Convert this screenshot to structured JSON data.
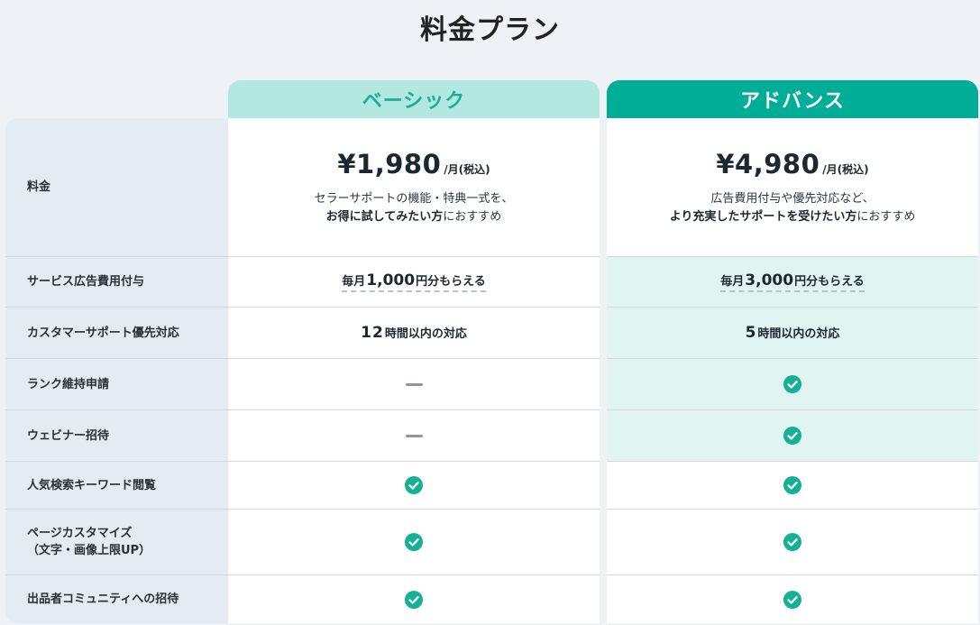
{
  "title": "料金プラン",
  "plans": {
    "basic": {
      "name": "ベーシック",
      "price": "¥1,980",
      "price_unit": "/月(税込)",
      "desc_line1": "セラーサポートの機能・特典一式を、",
      "desc_line2_bold": "お得に試してみたい方",
      "desc_line2_rest": "におすすめ",
      "ad_prefix": "毎月",
      "ad_amount": "1,000",
      "ad_suffix": "円分もらえる",
      "support_hours": "12",
      "support_suffix": "時間以内の対応"
    },
    "advance": {
      "name": "アドバンス",
      "price": "¥4,980",
      "price_unit": "/月(税込)",
      "desc_line1": "広告費用付与や優先対応など、",
      "desc_line2_bold": "より充実したサポートを受けたい方",
      "desc_line2_rest": "におすすめ",
      "ad_prefix": "毎月",
      "ad_amount": "3,000",
      "ad_suffix": "円分もらえる",
      "support_hours": "5",
      "support_suffix": "時間以内の対応"
    }
  },
  "rows": {
    "price": "料金",
    "ad": "サービス広告費用付与",
    "support": "カスタマーサポート優先対応",
    "rank": "ランク維持申請",
    "webinar": "ウェビナー招待",
    "keyword": "人気検索キーワード閲覧",
    "page_custom_line1": "ページカスタマイズ",
    "page_custom_line2": "（文字・画像上限UP）",
    "community": "出品者コミュニティへの招待"
  },
  "features": {
    "rank": {
      "basic": "none",
      "advance": "check"
    },
    "webinar": {
      "basic": "none",
      "advance": "check"
    },
    "keyword": {
      "basic": "check",
      "advance": "check"
    },
    "page_custom": {
      "basic": "check",
      "advance": "check"
    },
    "community": {
      "basic": "check",
      "advance": "check"
    }
  },
  "colors": {
    "accent": "#00ae97",
    "accent_light": "#b3e8e1",
    "highlight_bg": "#e0f5f2",
    "label_bg": "#e5ebf2",
    "check": "#16b095",
    "dash": "#8d969d"
  },
  "icons": {
    "check": "check-circle-icon",
    "none": "dash-icon"
  }
}
